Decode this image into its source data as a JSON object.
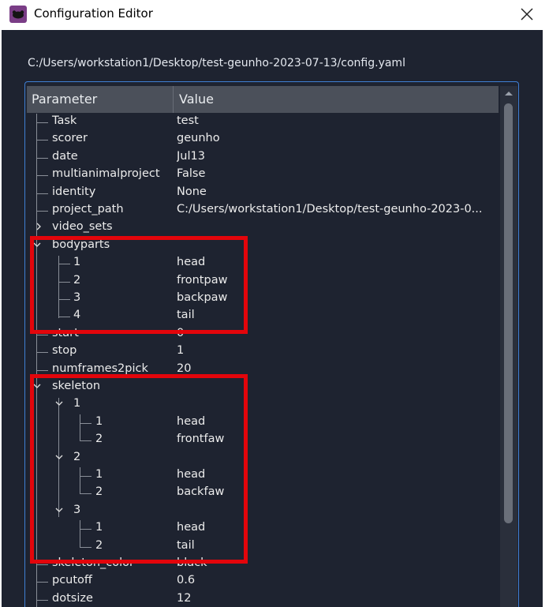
{
  "window": {
    "title": "Configuration Editor",
    "icon": "deeplabcut-mouse-icon",
    "close_icon": "close-icon"
  },
  "config_path": "C:/Users/workstation1/Desktop/test-geunho-2023-07-13/config.yaml",
  "tree": {
    "headers": {
      "parameter": "Parameter",
      "value": "Value"
    },
    "rows": [
      {
        "param": "Task",
        "value": "test"
      },
      {
        "param": "scorer",
        "value": "geunho"
      },
      {
        "param": "date",
        "value": "Jul13"
      },
      {
        "param": "multianimalproject",
        "value": "False"
      },
      {
        "param": "identity",
        "value": "None"
      },
      {
        "param": "project_path",
        "value": "C:/Users/workstation1/Desktop/test-geunho-2023-0..."
      },
      {
        "param": "video_sets",
        "value": "",
        "expand": "collapsed"
      },
      {
        "param": "bodyparts",
        "value": "",
        "expand": "expanded"
      },
      {
        "param": "1",
        "value": "head"
      },
      {
        "param": "2",
        "value": "frontpaw"
      },
      {
        "param": "3",
        "value": "backpaw"
      },
      {
        "param": "4",
        "value": "tail"
      },
      {
        "param": "start",
        "value": "0"
      },
      {
        "param": "stop",
        "value": "1"
      },
      {
        "param": "numframes2pick",
        "value": "20"
      },
      {
        "param": "skeleton",
        "value": "",
        "expand": "expanded"
      },
      {
        "param": "1",
        "value": "",
        "expand": "expanded"
      },
      {
        "param": "1",
        "value": "head"
      },
      {
        "param": "2",
        "value": "frontfaw"
      },
      {
        "param": "2",
        "value": "",
        "expand": "expanded"
      },
      {
        "param": "1",
        "value": "head"
      },
      {
        "param": "2",
        "value": "backfaw"
      },
      {
        "param": "3",
        "value": "",
        "expand": "expanded"
      },
      {
        "param": "1",
        "value": "head"
      },
      {
        "param": "2",
        "value": "tail"
      },
      {
        "param": "skeleton_color",
        "value": "black"
      },
      {
        "param": "pcutoff",
        "value": "0.6"
      },
      {
        "param": "dotsize",
        "value": "12"
      }
    ]
  },
  "annotation_color": "#e3050b",
  "accent_color": "#3f7fd4"
}
